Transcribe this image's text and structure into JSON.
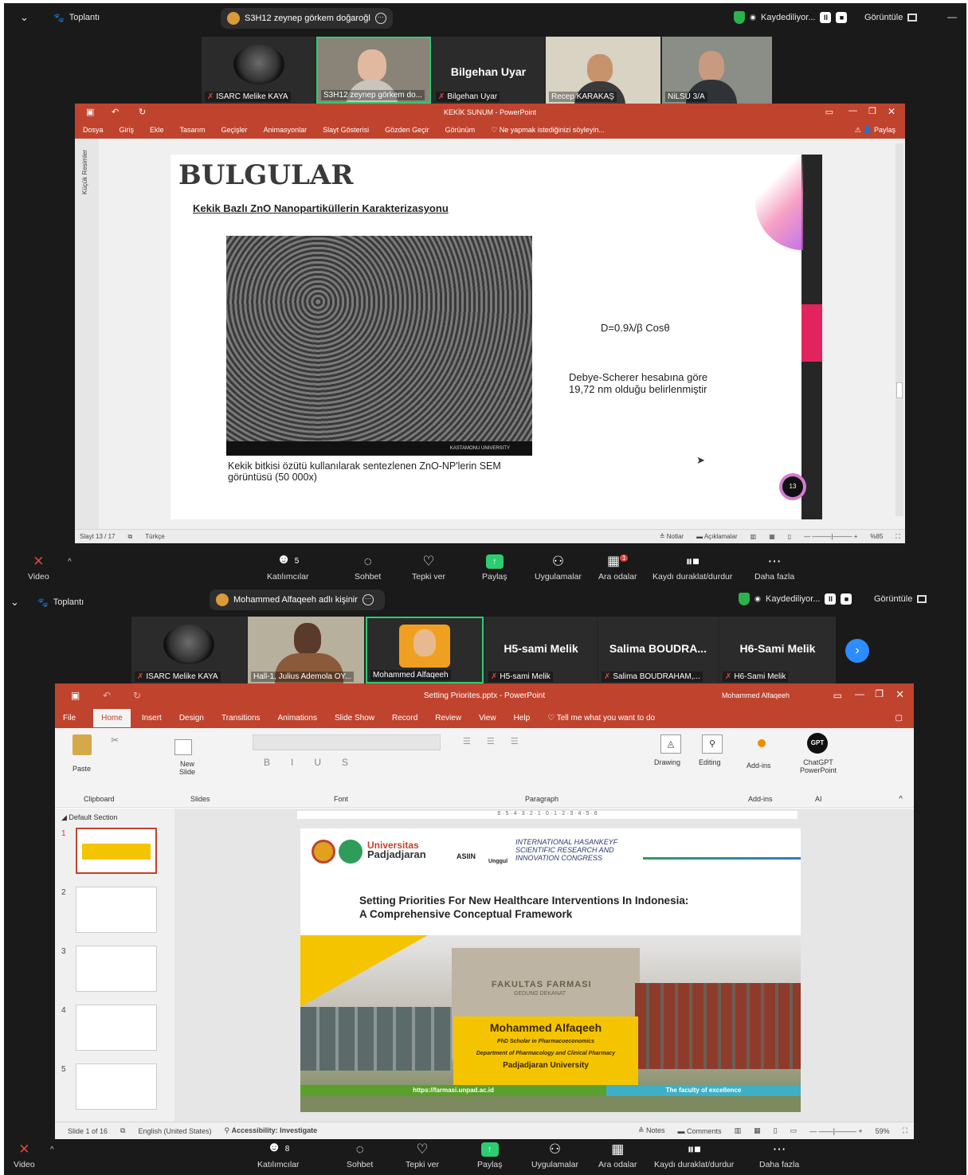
{
  "zoom1": {
    "meeting_label": "Toplantı",
    "share_pill": "S3H12 zeynep görkem doğaroğl",
    "recording_label": "Kaydediliyor...",
    "view_label": "Görüntüle",
    "participants": [
      {
        "name": "ISARC Melike KAYA"
      },
      {
        "name": "S3H12 zeynep görkem do..."
      },
      {
        "name": "Bilgehan Uyar",
        "big": "Bilgehan Uyar"
      },
      {
        "name": "Recep KARAKAŞ"
      },
      {
        "name": "NiLSU 3/A"
      }
    ],
    "ppt": {
      "window_title": "KEKİK SUNUM - PowerPoint",
      "menu": [
        "Dosya",
        "Giriş",
        "Ekle",
        "Tasarım",
        "Geçişler",
        "Animasyonlar",
        "Slayt Gösterisi",
        "Gözden Geçir",
        "Görünüm"
      ],
      "tell_me": "Ne yapmak istediğinizi söyleyin...",
      "share_label": "Paylaş",
      "side_panel": "Küçük Resimler",
      "slide": {
        "heading": "BULGULAR",
        "subtitle": "Kekik Bazlı ZnO Nanopartiküllerin Karakterizasyonu",
        "formula": "D=0.9λ/β Cosθ",
        "result_line1": "Debye-Scherer hesabına göre",
        "result_line2": "19,72 nm olduğu belirlenmiştir",
        "caption_line1": "Kekik bitkisi özütü kullanılarak sentezlenen ZnO-NP'lerin SEM",
        "caption_line2": "görüntüsü (50 000x)",
        "sem_footer": "KASTAMONU UNIVERSITY",
        "page_badge": "13"
      },
      "status": {
        "slide_count": "Slayt 13 / 17",
        "language": "Türkçe",
        "notes": "Notlar",
        "comments": "Açıklamalar",
        "zoom": "%85"
      }
    },
    "toolbar": [
      {
        "label": "Video",
        "icon": "video-off-icon",
        "glyph": "✕"
      },
      {
        "label": "Katılımcılar",
        "icon": "participants-icon",
        "glyph": "👥",
        "count": "5"
      },
      {
        "label": "Sohbet",
        "icon": "chat-icon",
        "glyph": "💬"
      },
      {
        "label": "Tepki ver",
        "icon": "reaction-icon",
        "glyph": "♡"
      },
      {
        "label": "Paylaş",
        "icon": "share-screen-icon",
        "glyph": "↑"
      },
      {
        "label": "Uygulamalar",
        "icon": "apps-icon",
        "glyph": "⚇"
      },
      {
        "label": "Ara odalar",
        "icon": "breakout-rooms-icon",
        "glyph": "▦",
        "badge": "1"
      },
      {
        "label": "Kaydı duraklat/durdur",
        "icon": "record-control-icon",
        "glyph": "⏸"
      },
      {
        "label": "Daha fazla",
        "icon": "more-icon",
        "glyph": "⋯"
      }
    ]
  },
  "zoom2": {
    "meeting_label": "Toplantı",
    "share_pill": "Mohammed Alfaqeeh adlı kişinir",
    "recording_label": "Kaydediliyor...",
    "view_label": "Görüntüle",
    "participants": [
      {
        "name": "ISARC Melike KAYA"
      },
      {
        "name": "Hall-1, Julius Ademola OY..."
      },
      {
        "name": "Mohammed Alfaqeeh"
      },
      {
        "name": "H5-sami Melik",
        "big": "H5-sami Melik"
      },
      {
        "name": "Salima BOUDRAHAM,...",
        "big": "Salima BOUDRA..."
      },
      {
        "name": "H6-Sami Melik",
        "big": "H6-Sami Melik"
      }
    ],
    "ppt": {
      "window_title": "Setting Priorites.pptx - PowerPoint",
      "user": "Mohammed Alfaqeeh",
      "tabs": [
        "File",
        "Home",
        "Insert",
        "Design",
        "Transitions",
        "Animations",
        "Slide Show",
        "Record",
        "Review",
        "View",
        "Help"
      ],
      "tell_me": "Tell me what you want to do",
      "ribbon": {
        "paste": "Paste",
        "clipboard": "Clipboard",
        "new_slide": "New Slide",
        "slides": "Slides",
        "font": "Font",
        "paragraph": "Paragraph",
        "drawing": "Drawing",
        "editing": "Editing",
        "addins": "Add-ins",
        "addins_group": "Add-ins",
        "chatgpt": "ChatGPT PowerPoint",
        "ai_group": "AI",
        "gpt_badge": "GPT"
      },
      "section": "Default Section",
      "thumbs": [
        "1",
        "2",
        "3",
        "4",
        "5"
      ],
      "slide": {
        "univ1": "Universitas",
        "univ2": "Padjadjaran",
        "asiin": "ASIIN",
        "unggul": "Unggul",
        "congress1": "INTERNATIONAL HASANKEYF",
        "congress2": "SCIENTIFIC RESEARCH AND",
        "congress3": "INNOVATION CONGRESS",
        "title1": "Setting Priorities For New Healthcare Interventions In Indonesia:",
        "title2": "A Comprehensive Conceptual Framework",
        "building1": "FAKULTAS FARMASI",
        "building2": "GEDUNG DEKANAT",
        "author": "Mohammed Alfaqeeh",
        "role": "PhD Scholar in Pharmacoeconomics",
        "dept": "Department of Pharmacology and Clinical Pharmacy",
        "univ_full": "Padjadjaran University",
        "url": "https://farmasi.unpad.ac.id",
        "tagline": "The faculty of excellence"
      },
      "status": {
        "slide_count": "Slide 1 of 16",
        "language": "English (United States)",
        "accessibility": "Accessibility: Investigate",
        "notes": "Notes",
        "comments": "Comments",
        "zoom": "59%"
      }
    },
    "toolbar": [
      {
        "label": "Video",
        "icon": "video-off-icon",
        "glyph": "✕"
      },
      {
        "label": "Katılımcılar",
        "icon": "participants-icon",
        "glyph": "👥",
        "count": "8"
      },
      {
        "label": "Sohbet",
        "icon": "chat-icon",
        "glyph": "💬"
      },
      {
        "label": "Tepki ver",
        "icon": "reaction-icon",
        "glyph": "♡"
      },
      {
        "label": "Paylaş",
        "icon": "share-screen-icon",
        "glyph": "↑"
      },
      {
        "label": "Uygulamalar",
        "icon": "apps-icon",
        "glyph": "⚇"
      },
      {
        "label": "Ara odalar",
        "icon": "breakout-rooms-icon",
        "glyph": "▦"
      },
      {
        "label": "Kaydı duraklat/durdur",
        "icon": "record-control-icon",
        "glyph": "⏸"
      },
      {
        "label": "Daha fazla",
        "icon": "more-icon",
        "glyph": "⋯"
      }
    ]
  },
  "colors": {
    "ppt_red": "#c0432e",
    "zoom_green": "#2ecc71",
    "zoom_bg": "#1a1a1a",
    "mute_red": "#e0443c",
    "slide_yellow": "#f5c400"
  }
}
